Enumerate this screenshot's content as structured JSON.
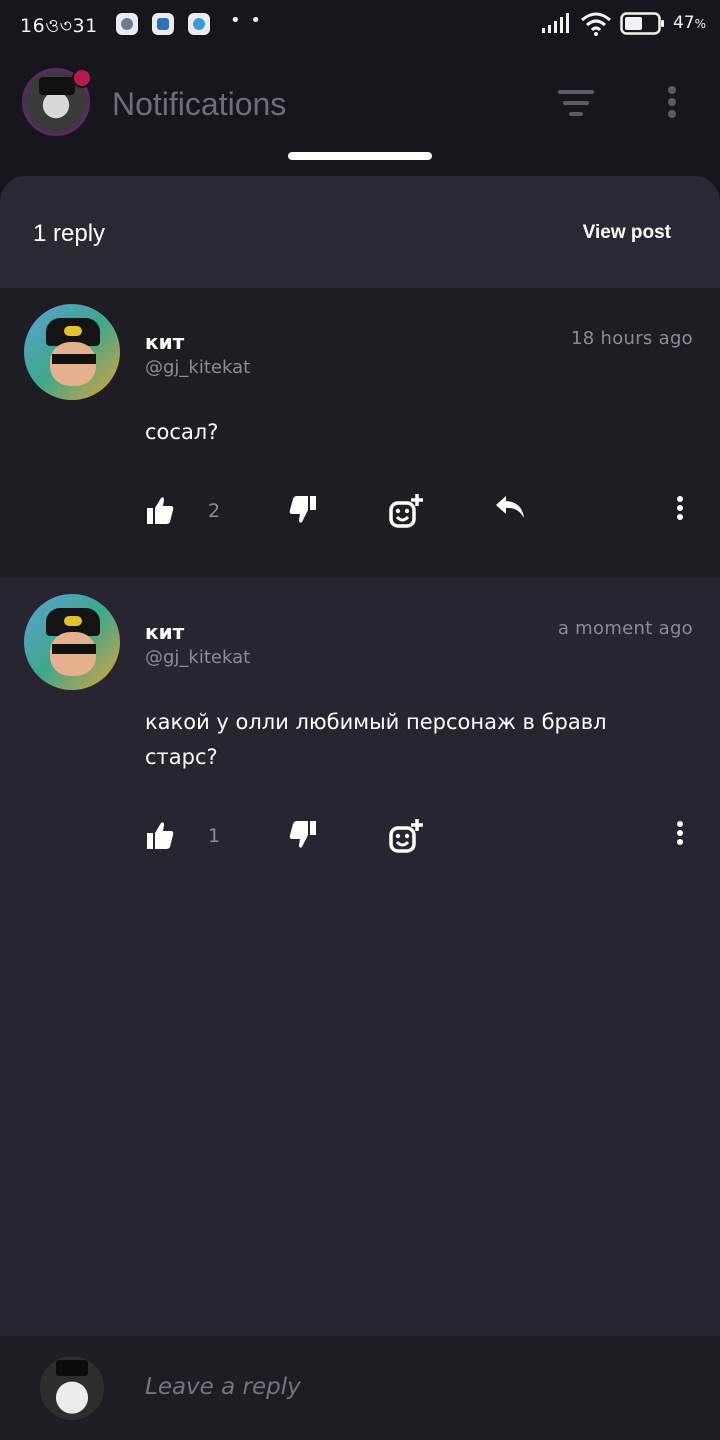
{
  "status_bar": {
    "time": "16",
    "clock_rest": "31",
    "battery": "47",
    "battery_unit": "%",
    "icons": [
      "whatsapp-icon",
      "vk-icon",
      "telegram-icon",
      "more-dots-icon",
      "signal-icon",
      "wifi-icon",
      "battery-icon"
    ]
  },
  "header": {
    "title": "Notifications",
    "filter_icon": "filter-icon",
    "more_icon": "more-vertical-icon",
    "badge_color": "#b51c4a"
  },
  "thread": {
    "reply_count": "1 reply",
    "view_post": "View post"
  },
  "comments": [
    {
      "name": "кит",
      "handle": "@gj_kitekat",
      "time": "18 hours ago",
      "text": "сосал?",
      "likes": "2",
      "actions": [
        "like-icon",
        "dislike-icon",
        "add-reaction-icon",
        "reply-icon",
        "more-vertical-icon"
      ]
    },
    {
      "name": "кит",
      "handle": "@gj_kitekat",
      "time": "a moment ago",
      "text": "какой у олли любимый персонаж в бравл старс?",
      "likes": "1",
      "actions": [
        "like-icon",
        "dislike-icon",
        "add-reaction-icon",
        "more-vertical-icon"
      ]
    }
  ],
  "reply_bar": {
    "placeholder": "Leave a reply"
  },
  "colors": {
    "background": "#17161c",
    "sheet": "#272530",
    "highlight_comment": "#1e1d24",
    "muted_text": "#8d8c96"
  }
}
